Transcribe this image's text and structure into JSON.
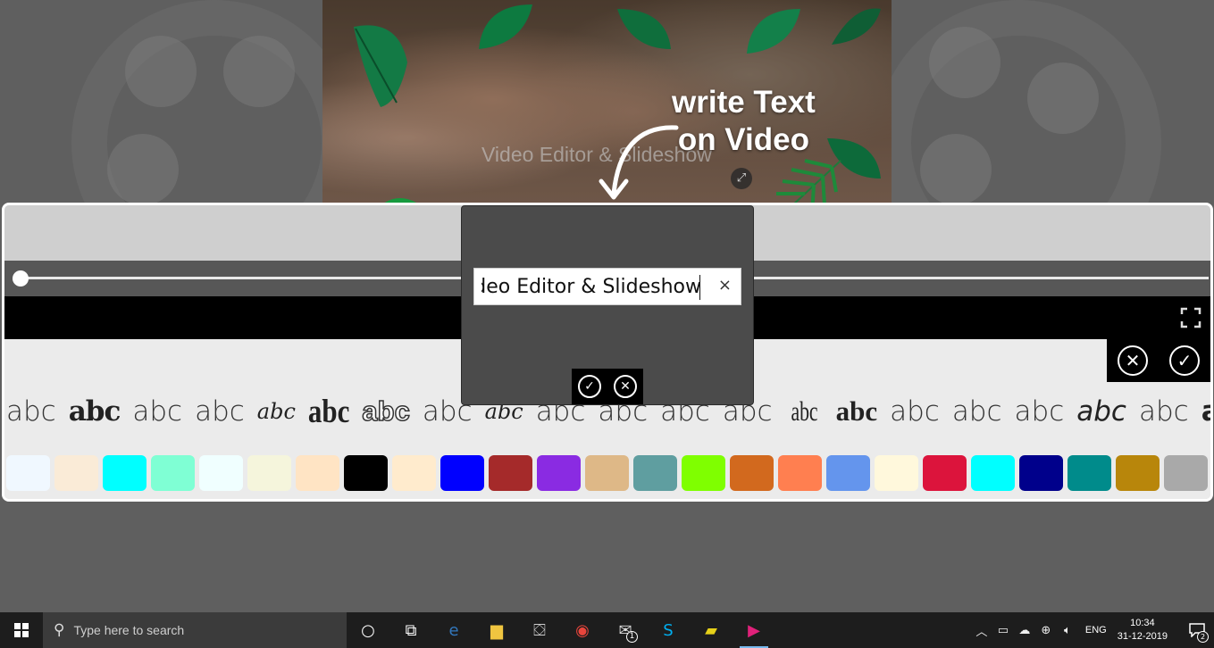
{
  "video": {
    "watermark_text": "Video Editor & Slideshow",
    "resize_icon": "resize-arrows-icon"
  },
  "callout": {
    "line1": "write Text",
    "line2": "on Video"
  },
  "text_dialog": {
    "input_value": "Video Editor & Slideshow",
    "clear_label": "×",
    "confirm_icon": "check-icon",
    "cancel_icon": "close-icon"
  },
  "toolbar": {
    "cancel_icon": "close-icon",
    "confirm_icon": "check-icon",
    "fullscreen_icon": "fullscreen-icon"
  },
  "seek": {
    "progress": 0
  },
  "font_samples": [
    {
      "text": "abc",
      "style": "light"
    },
    {
      "text": "abc",
      "style": "grunge"
    },
    {
      "text": "abc",
      "style": "light"
    },
    {
      "text": "abc",
      "style": "light"
    },
    {
      "text": "abc",
      "style": "script"
    },
    {
      "text": "abc",
      "style": "blackletter"
    },
    {
      "text": "abc",
      "style": "outline"
    },
    {
      "text": "abc",
      "style": "light"
    },
    {
      "text": "abc",
      "style": "script"
    },
    {
      "text": "abc",
      "style": "light"
    },
    {
      "text": "abc",
      "style": "light"
    },
    {
      "text": "abc",
      "style": "light"
    },
    {
      "text": "abc",
      "style": "light"
    },
    {
      "text": "abc",
      "style": "condensed"
    },
    {
      "text": "abc",
      "style": "heavy-serif"
    },
    {
      "text": "abc",
      "style": "light"
    },
    {
      "text": "abc",
      "style": "light"
    },
    {
      "text": "abc",
      "style": "light"
    },
    {
      "text": "abc",
      "style": "rounded"
    },
    {
      "text": "abc",
      "style": "light"
    },
    {
      "text": "a",
      "style": "bold"
    }
  ],
  "colors": [
    "#f0f8ff",
    "#faebd7",
    "#00ffff",
    "#7fffd4",
    "#f0ffff",
    "#f5f5dc",
    "#ffe4c4",
    "#000000",
    "#ffebcd",
    "#0000ff",
    "#a52a2a",
    "#8a2be2",
    "#deb887",
    "#5f9ea0",
    "#7fff00",
    "#d2691e",
    "#ff7f50",
    "#6495ed",
    "#fff8dc",
    "#dc143c",
    "#00ffff",
    "#00008b",
    "#008b8b",
    "#b8860b",
    "#a9a9a9",
    "#006400"
  ],
  "taskbar": {
    "search_placeholder": "Type here to search",
    "apps": [
      {
        "name": "cortana-icon",
        "glyph": "○"
      },
      {
        "name": "task-view-icon",
        "glyph": "⧉"
      },
      {
        "name": "edge-icon",
        "glyph": "e",
        "color": "#3277bc"
      },
      {
        "name": "file-explorer-icon",
        "glyph": "▆",
        "color": "#f0c540"
      },
      {
        "name": "store-icon",
        "glyph": "⛋",
        "color": "#cccccc"
      },
      {
        "name": "chrome-icon",
        "glyph": "◉",
        "color": "#e8453c"
      },
      {
        "name": "mail-icon",
        "glyph": "✉",
        "color": "#dddddd",
        "badge": "1"
      },
      {
        "name": "skype-icon",
        "glyph": "S",
        "color": "#00aff0"
      },
      {
        "name": "sticky-notes-icon",
        "glyph": "▰",
        "color": "#e6d019"
      },
      {
        "name": "video-editor-app-icon",
        "glyph": "▶",
        "color": "#e0217a",
        "active": true
      }
    ],
    "language": "ENG",
    "time": "10:34",
    "date": "31-12-2019",
    "notification_count": "2"
  }
}
